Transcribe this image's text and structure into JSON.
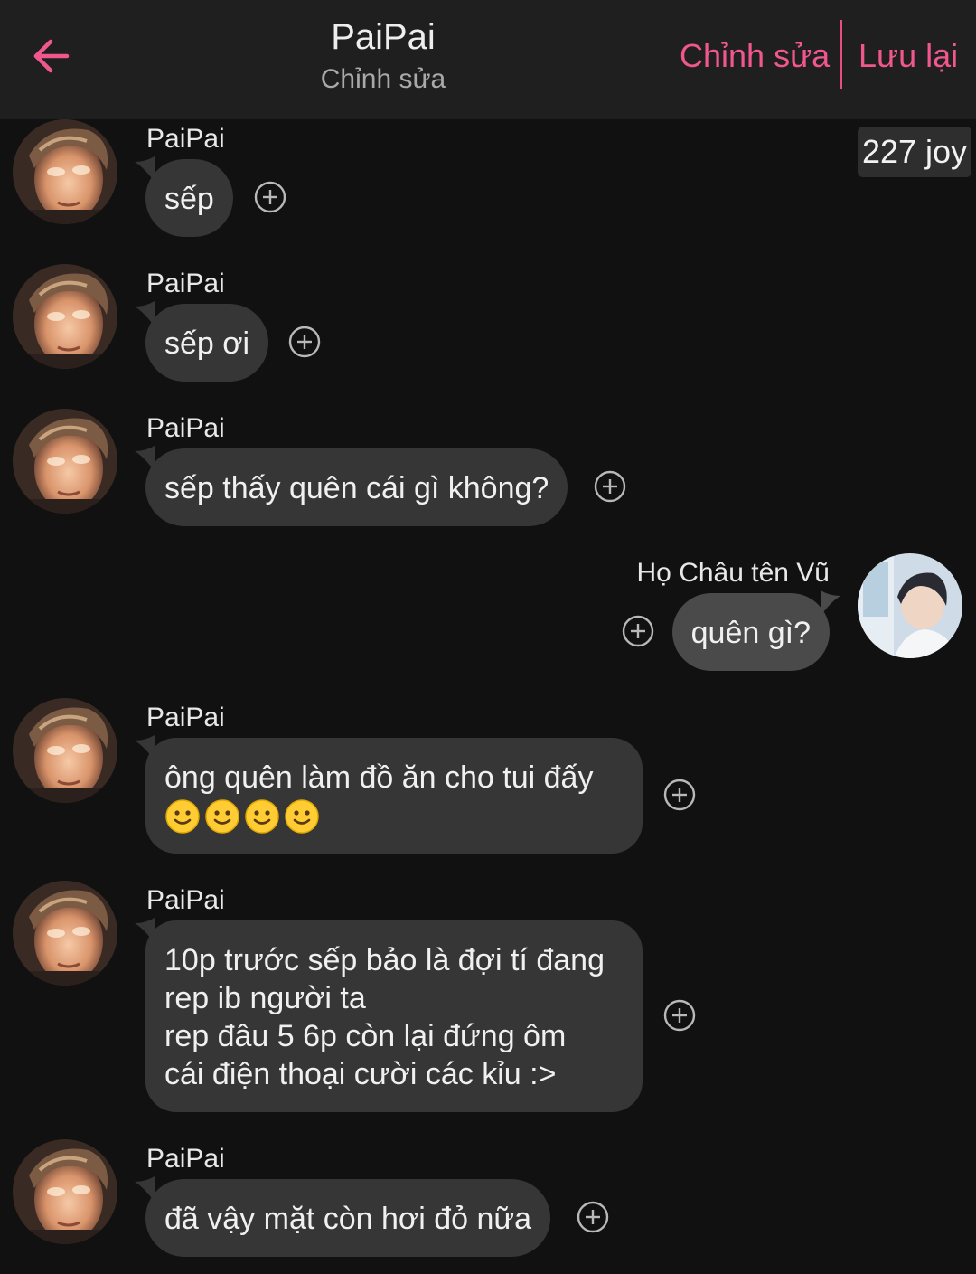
{
  "header": {
    "title": "PaiPai",
    "subtitle": "Chỉnh sửa",
    "edit_label": "Chỉnh sửa",
    "save_label": "Lưu lại"
  },
  "joy_badge": "227 joy",
  "colors": {
    "accent": "#f0578d",
    "bubble_other": "#363636",
    "bubble_self": "#4a4a4a",
    "background": "#111111"
  },
  "messages": [
    {
      "sender": "PaiPai",
      "side": "left",
      "text": "sếp"
    },
    {
      "sender": "PaiPai",
      "side": "left",
      "text": "sếp ơi"
    },
    {
      "sender": "PaiPai",
      "side": "left",
      "text": "sếp thấy quên cái gì không?"
    },
    {
      "sender": "Họ Châu tên Vũ",
      "side": "right",
      "text": "quên gì?"
    },
    {
      "sender": "PaiPai",
      "side": "left",
      "text": "ông quên làm đồ ăn cho tui đấy",
      "emoji": "🙂🙂🙂🙂"
    },
    {
      "sender": "PaiPai",
      "side": "left",
      "text": "10p trước sếp bảo là đợi tí đang\nrep ib người ta\nrep đâu 5 6p còn lại đứng ôm\ncái điện thoại cười các kỉu :>"
    },
    {
      "sender": "PaiPai",
      "side": "left",
      "text": "đã vậy mặt còn hơi đỏ nữa"
    }
  ]
}
